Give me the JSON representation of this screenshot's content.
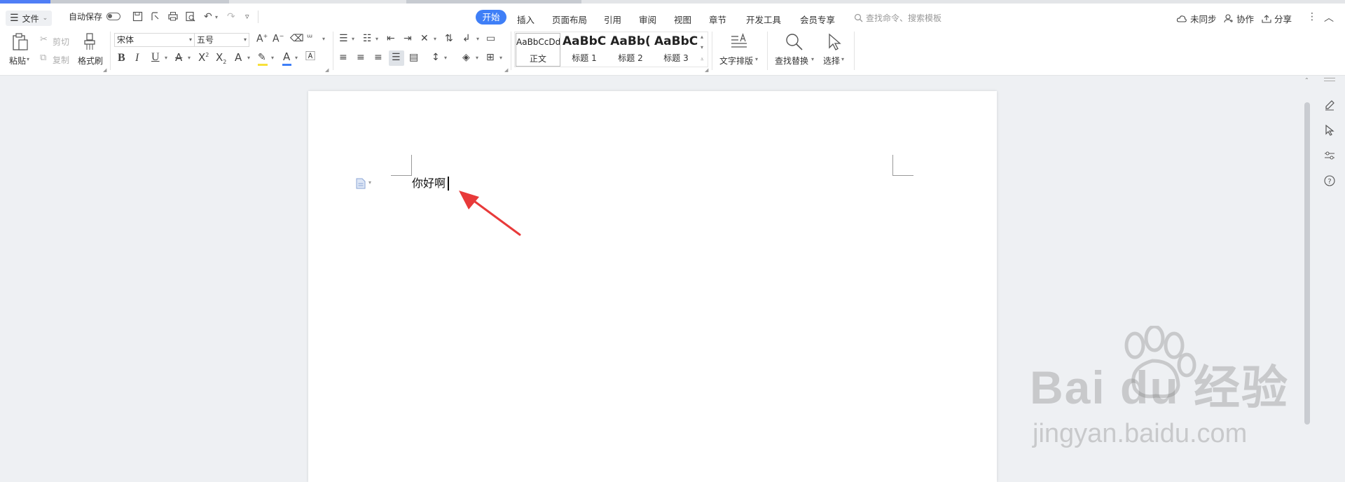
{
  "menubar": {
    "file_label": "文件",
    "autosave_label": "自动保存",
    "active_tab": "开始",
    "tabs": [
      "插入",
      "页面布局",
      "引用",
      "审阅",
      "视图",
      "章节",
      "开发工具",
      "会员专享"
    ],
    "search_placeholder": "查找命令、搜索模板",
    "unsynced_label": "未同步",
    "collab_label": "协作",
    "share_label": "分享"
  },
  "ribbon": {
    "paste_label": "粘贴",
    "cut_label": "剪切",
    "copy_label": "复制",
    "format_painter_label": "格式刷",
    "font_name": "宋体",
    "font_size": "五号",
    "styles": [
      {
        "sample": "AaBbCcDd",
        "name": "正文"
      },
      {
        "sample": "AaBbC",
        "name": "标题 1"
      },
      {
        "sample": "AaBb(",
        "name": "标题 2"
      },
      {
        "sample": "AaBbC",
        "name": "标题 3"
      }
    ],
    "text_layout_label": "文字排版",
    "find_replace_label": "查找替换",
    "select_label": "选择"
  },
  "document": {
    "text": "你好啊"
  },
  "watermark": {
    "brand": "Bai du 经验",
    "url": "jingyan.baidu.com"
  },
  "colors": {
    "accent": "#3f7ff7",
    "arrow": "#e83a3a"
  }
}
